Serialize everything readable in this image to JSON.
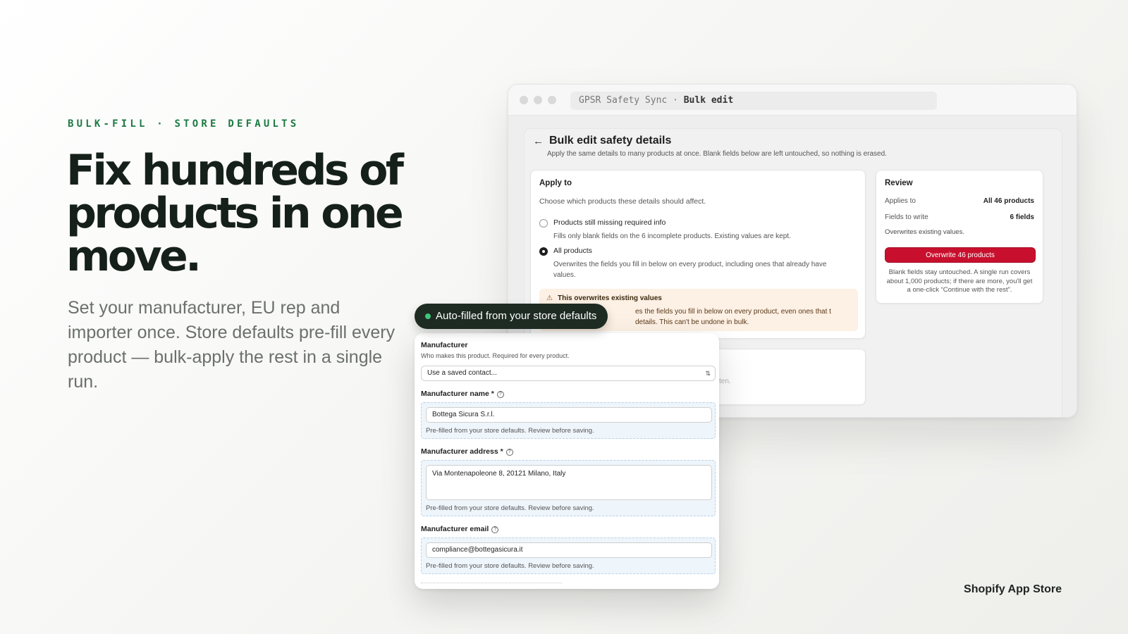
{
  "hero": {
    "eyebrow": "BULK-FILL · STORE DEFAULTS",
    "headline": "Fix hundreds of products in one move.",
    "subtext": "Set your manufacturer, EU rep and importer once. Store defaults pre-fill every product — bulk-apply the rest in a single run."
  },
  "footer": {
    "brand": "Shopify App Store"
  },
  "window": {
    "url_prefix": "GPSR Safety Sync · ",
    "url_page": "Bulk edit"
  },
  "page": {
    "title": "Bulk edit safety details",
    "description": "Apply the same details to many products at once. Blank fields below are left untouched, so nothing is erased."
  },
  "apply_to": {
    "heading": "Apply to",
    "prompt": "Choose which products these details should affect.",
    "options": [
      {
        "label": "Products still missing required info",
        "description": "Fills only blank fields on the 6 incomplete products. Existing values are kept.",
        "selected": false
      },
      {
        "label": "All products",
        "description": "Overwrites the fields you fill in below on every product, including ones that already have values.",
        "selected": true
      }
    ],
    "warning": {
      "title": "This overwrites existing values",
      "text": "es the fields you fill in below on every product, even ones that t details. This can't be undone in bulk."
    },
    "partial_hint": "itten."
  },
  "review": {
    "heading": "Review",
    "applies_to_label": "Applies to",
    "applies_to_value": "All 46 products",
    "fields_label": "Fields to write",
    "fields_value": "6 fields",
    "note": "Overwrites existing values.",
    "button": "Overwrite 46 products",
    "footnote": "Blank fields stay untouched. A single run covers about 1,000 products; if there are more, you'll get a one-click “Continue with the rest”."
  },
  "badge": {
    "text": "Auto-filled from your store defaults"
  },
  "form": {
    "section_label": "Manufacturer",
    "section_help": "Who makes this product. Required for every product.",
    "contact_select": "Use a saved contact...",
    "prefill_note": "Pre-filled from your store defaults. Review before saving.",
    "fields": {
      "name_label": "Manufacturer name *",
      "name_value": "Bottega Sicura S.r.l.",
      "address_label": "Manufacturer address *",
      "address_value": "Via Montenapoleone 8, 20121 Milano, Italy",
      "email_label": "Manufacturer email",
      "email_value": "compliance@bottegasicura.it"
    }
  },
  "colors": {
    "accent_green": "#1d7a43",
    "danger": "#c8102e",
    "badge_bg": "#1d2b22",
    "warning_bg": "#fdf0e4",
    "prefill_bg": "#eef5fb"
  },
  "icons": [
    "back-arrow-icon",
    "warning-icon",
    "help-icon",
    "chevron-updown-icon",
    "status-dot-icon"
  ]
}
